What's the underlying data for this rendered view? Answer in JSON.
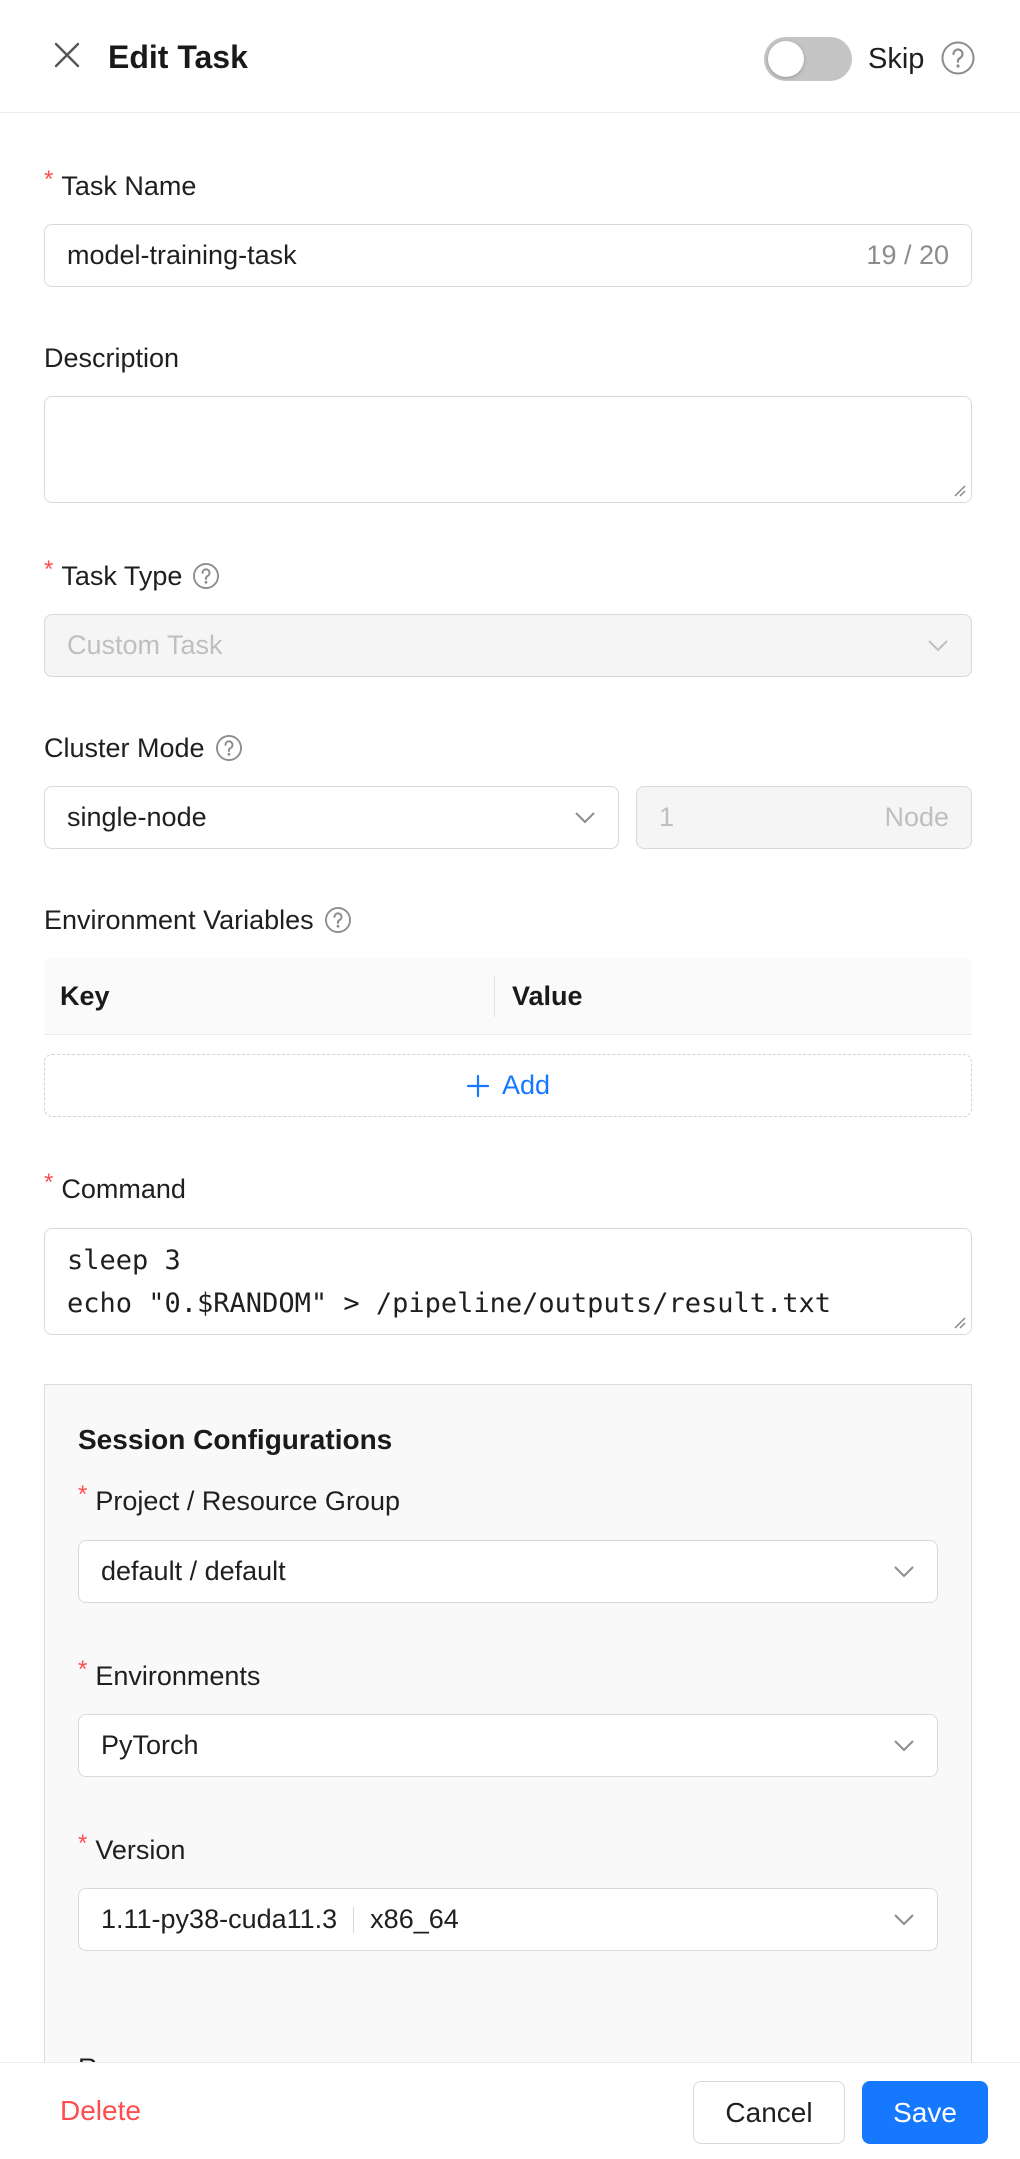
{
  "header": {
    "title": "Edit Task",
    "skip_label": "Skip",
    "skip_enabled": false
  },
  "form": {
    "task_name": {
      "label": "Task Name",
      "value": "model-training-task",
      "counter": "19 / 20"
    },
    "description": {
      "label": "Description",
      "value": ""
    },
    "task_type": {
      "label": "Task Type",
      "value": "Custom Task"
    },
    "cluster_mode": {
      "label": "Cluster Mode",
      "value": "single-node",
      "node_count": "1",
      "node_unit": "Node"
    },
    "env_vars": {
      "label": "Environment Variables",
      "key_header": "Key",
      "value_header": "Value",
      "add_label": "Add"
    },
    "command": {
      "label": "Command",
      "value": "sleep 3\necho \"0.$RANDOM\" > /pipeline/outputs/result.txt"
    }
  },
  "session": {
    "title": "Session Configurations",
    "project": {
      "label": "Project / Resource Group",
      "value": "default / default"
    },
    "environments": {
      "label": "Environments",
      "value": "PyTorch"
    },
    "version": {
      "label": "Version",
      "value": "1.11-py38-cuda11.3",
      "arch": "x86_64"
    },
    "partial_label": "R"
  },
  "footer": {
    "delete_label": "Delete",
    "cancel_label": "Cancel",
    "save_label": "Save"
  },
  "colors": {
    "primary": "#1677ff",
    "danger": "#ff4d4f",
    "toggle_off": "#c4c4c4"
  }
}
